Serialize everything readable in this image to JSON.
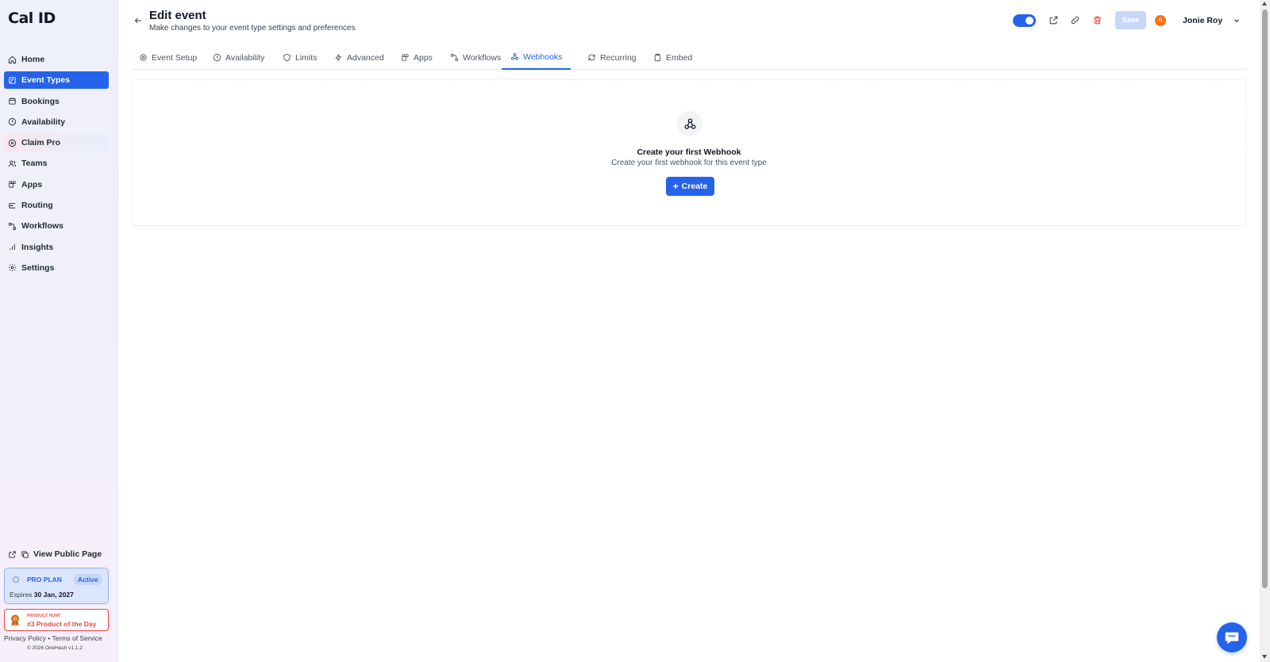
{
  "app": {
    "logo_text": "Cal ID"
  },
  "sidebar": {
    "items": [
      {
        "label": "Home",
        "icon": "home-icon"
      },
      {
        "label": "Event Types",
        "icon": "event-types-icon",
        "active": true
      },
      {
        "label": "Bookings",
        "icon": "calendar-icon"
      },
      {
        "label": "Availability",
        "icon": "clock-icon"
      },
      {
        "label": "Claim Pro",
        "icon": "claim-pro-icon"
      },
      {
        "label": "Teams",
        "icon": "users-icon"
      },
      {
        "label": "Apps",
        "icon": "apps-icon"
      },
      {
        "label": "Routing",
        "icon": "routing-icon"
      },
      {
        "label": "Workflows",
        "icon": "workflows-icon"
      },
      {
        "label": "Insights",
        "icon": "bar-chart-icon"
      },
      {
        "label": "Settings",
        "icon": "gear-icon"
      }
    ],
    "view_public_page": "View Public Page",
    "pro_plan": {
      "title": "PRO PLAN",
      "badge": "Active",
      "expires_label": "Expires",
      "expires_date": "30 Jan, 2027"
    },
    "product_hunt": {
      "small": "PRODUCT HUNT",
      "big": "#3 Product of the Day"
    },
    "footer": {
      "privacy": "Privacy Policy",
      "separator": "•",
      "terms": "Terms of Service",
      "copyright": "© 2026 OneHash v1.1.2"
    }
  },
  "header": {
    "title": "Edit event",
    "subtitle": "Make changes to your event type settings and preferences",
    "toggle_on": true,
    "save_label": "Save",
    "user": {
      "initial": "G",
      "name": "Jonie Roy"
    }
  },
  "tabs": [
    {
      "label": "Event Setup",
      "icon": "gear-icon"
    },
    {
      "label": "Availability",
      "icon": "clock-icon"
    },
    {
      "label": "Limits",
      "icon": "shield-icon"
    },
    {
      "label": "Advanced",
      "icon": "bolt-icon"
    },
    {
      "label": "Apps",
      "icon": "apps-icon"
    },
    {
      "label": "Workflows",
      "icon": "workflows-icon"
    },
    {
      "label": "Webhooks",
      "icon": "webhook-icon",
      "active": true
    },
    {
      "label": "Recurring",
      "icon": "repeat-icon"
    },
    {
      "label": "Embed",
      "icon": "clipboard-icon"
    }
  ],
  "empty_state": {
    "title": "Create your first Webhook",
    "description": "Create your first webhook for this event type",
    "button_label": "Create"
  },
  "colors": {
    "accent": "#2563eb",
    "danger": "#ef4444",
    "avatar": "#f97316"
  }
}
